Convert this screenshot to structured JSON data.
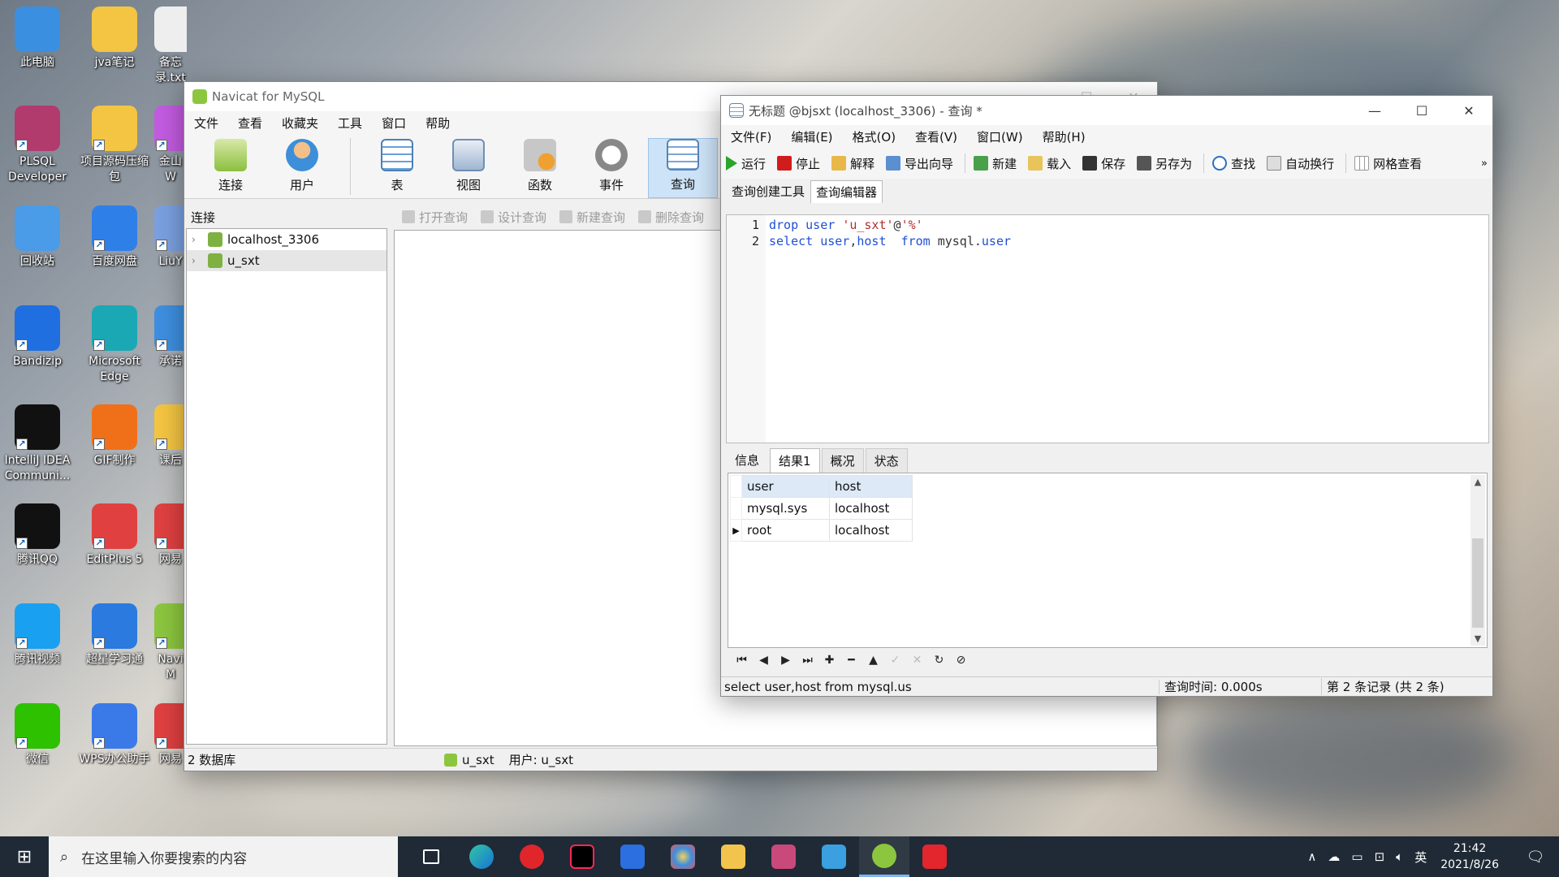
{
  "desktop": {
    "icons": [
      {
        "label": "此电脑"
      },
      {
        "label": "jva笔记"
      },
      {
        "label": "备忘录.txt"
      },
      {
        "label": "PLSQL Developer"
      },
      {
        "label": "项目源码压缩包"
      },
      {
        "label": "金山W"
      },
      {
        "label": "回收站"
      },
      {
        "label": "百度网盘"
      },
      {
        "label": "LiuY"
      },
      {
        "label": "Bandizip"
      },
      {
        "label": "Microsoft Edge"
      },
      {
        "label": "承诺"
      },
      {
        "label": "IntelliJ IDEA Communi..."
      },
      {
        "label": "GIF制作"
      },
      {
        "label": "课后"
      },
      {
        "label": "腾讯QQ"
      },
      {
        "label": "EditPlus 5"
      },
      {
        "label": "网易"
      },
      {
        "label": "腾讯视频"
      },
      {
        "label": "超星学习通"
      },
      {
        "label": "Navi M"
      },
      {
        "label": "微信"
      },
      {
        "label": "WPS办公助手"
      },
      {
        "label": "网易"
      }
    ]
  },
  "navicat": {
    "title": "Navicat for MySQL",
    "menu": [
      "文件",
      "查看",
      "收藏夹",
      "工具",
      "窗口",
      "帮助"
    ],
    "big_tools": [
      {
        "label": "连接",
        "icon": "connect-icon"
      },
      {
        "label": "用户",
        "icon": "user-icon"
      },
      {
        "label": "表",
        "icon": "table-icon"
      },
      {
        "label": "视图",
        "icon": "view-icon"
      },
      {
        "label": "函数",
        "icon": "function-icon"
      },
      {
        "label": "事件",
        "icon": "event-icon"
      },
      {
        "label": "查询",
        "icon": "query-icon"
      }
    ],
    "left_header": "连接",
    "tree": [
      {
        "label": "localhost_3306",
        "selected": false
      },
      {
        "label": "u_sxt",
        "selected": true
      }
    ],
    "object_toolbar": [
      "打开查询",
      "设计查询",
      "新建查询",
      "删除查询"
    ],
    "status": {
      "db_count": "2 数据库",
      "connection": "u_sxt",
      "user": "用户: u_sxt"
    }
  },
  "query_window": {
    "title": "无标题 @bjsxt (localhost_3306) - 查询 *",
    "menu": [
      "文件(F)",
      "编辑(E)",
      "格式(O)",
      "查看(V)",
      "窗口(W)",
      "帮助(H)"
    ],
    "toolbar": [
      "运行",
      "停止",
      "解释",
      "导出向导",
      "新建",
      "载入",
      "保存",
      "另存为",
      "查找",
      "自动换行",
      "网格查看"
    ],
    "tabs": [
      "查询创建工具",
      "查询编辑器"
    ],
    "active_tab": "查询编辑器",
    "sql_lines": [
      {
        "num": "1",
        "tokens": [
          [
            "kw",
            "drop"
          ],
          [
            "pl",
            " "
          ],
          [
            "kw",
            "user"
          ],
          [
            "pl",
            " "
          ],
          [
            "str",
            "'u_sxt'"
          ],
          [
            "pl",
            "@"
          ],
          [
            "str",
            "'%'"
          ]
        ]
      },
      {
        "num": "2",
        "tokens": [
          [
            "kw",
            "select"
          ],
          [
            "pl",
            " "
          ],
          [
            "kw",
            "user"
          ],
          [
            "pl",
            ","
          ],
          [
            "kw",
            "host"
          ],
          [
            "pl",
            "  "
          ],
          [
            "kw",
            "from"
          ],
          [
            "pl",
            " mysql."
          ],
          [
            "kw",
            "user"
          ]
        ]
      }
    ],
    "result_tabs": [
      "信息",
      "结果1",
      "概况",
      "状态"
    ],
    "active_result_tab": "结果1",
    "columns": [
      "user",
      "host"
    ],
    "rows": [
      [
        "mysql.sys",
        "localhost"
      ],
      [
        "root",
        "localhost"
      ]
    ],
    "status": {
      "sql": "select user,host  from mysql.us",
      "time": "查询时间: 0.000s",
      "records": "第 2 条记录 (共 2 条)"
    }
  },
  "taskbar": {
    "search_placeholder": "在这里输入你要搜索的内容",
    "time": "21:42",
    "date": "2021/8/26",
    "ime": "英"
  }
}
